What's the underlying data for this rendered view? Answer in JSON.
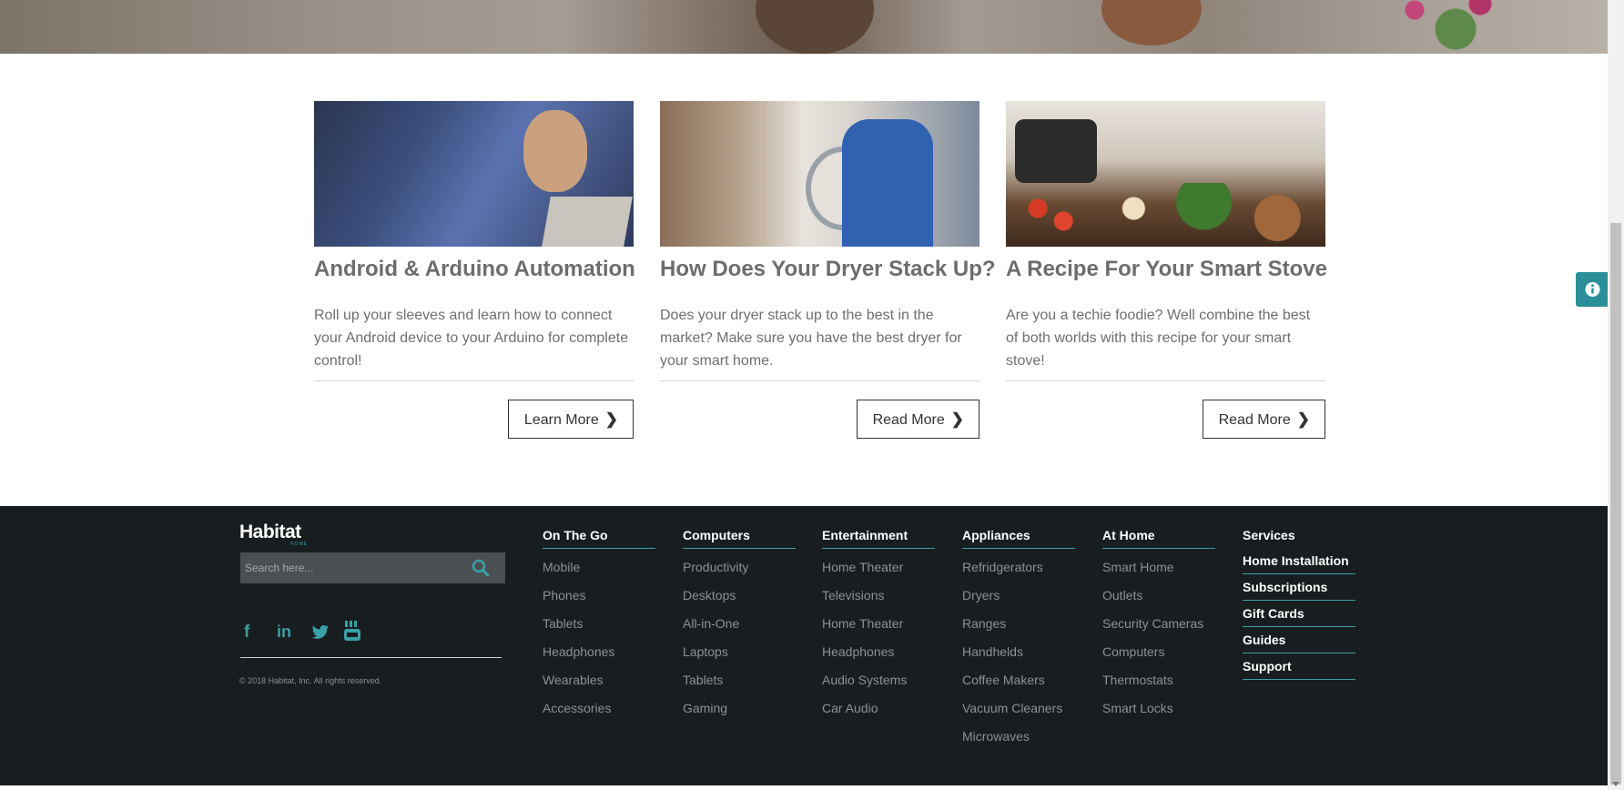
{
  "cards": [
    {
      "title": "Android & Arduino Automation",
      "text": "Roll up your sleeves and learn how to connect your Android device to your Arduino for complete control!",
      "button": "Learn More"
    },
    {
      "title": "How Does Your Dryer Stack Up?",
      "text": "Does your dryer stack up to the best in the market? Make sure you have the best dryer for your smart home.",
      "button": "Read More"
    },
    {
      "title": "A Recipe For Your Smart Stove",
      "text": "Are you a techie foodie? Well combine the best of both worlds with this recipe for your smart stove!",
      "button": "Read More"
    }
  ],
  "footer": {
    "logo": "Habitat",
    "logo_sub": "HOME",
    "search_placeholder": "Search here...",
    "copyright": "© 2018 Habitat, Inc. All rights reserved.",
    "social_icons": [
      "facebook-icon",
      "linkedin-icon",
      "twitter-icon",
      "youtube-icon"
    ],
    "columns": [
      {
        "heading": "On The Go",
        "items": [
          "Mobile",
          "Phones",
          "Tablets",
          "Headphones",
          "Wearables",
          "Accessories"
        ]
      },
      {
        "heading": "Computers",
        "items": [
          "Productivity",
          "Desktops",
          "All-in-One",
          "Laptops",
          "Tablets",
          "Gaming"
        ]
      },
      {
        "heading": "Entertainment",
        "items": [
          "Home Theater",
          "Televisions",
          "Home Theater",
          "Headphones",
          "Audio Systems",
          "Car Audio"
        ]
      },
      {
        "heading": "Appliances",
        "items": [
          "Refridgerators",
          "Dryers",
          "Ranges",
          "Handhelds",
          "Coffee Makers",
          "Vacuum Cleaners",
          "Microwaves"
        ]
      },
      {
        "heading": "At Home",
        "items": [
          "Smart Home",
          "Outlets",
          "Security Cameras",
          "Computers",
          "Thermostats",
          "Smart Locks"
        ]
      }
    ],
    "services": {
      "heading": "Services",
      "items": [
        "Home Installation",
        "Subscriptions",
        "Gift Cards",
        "Guides",
        "Support"
      ]
    }
  },
  "colors": {
    "accent": "#3aa0a8",
    "footer_bg": "#181d1f",
    "info_button": "#2a8f98"
  }
}
